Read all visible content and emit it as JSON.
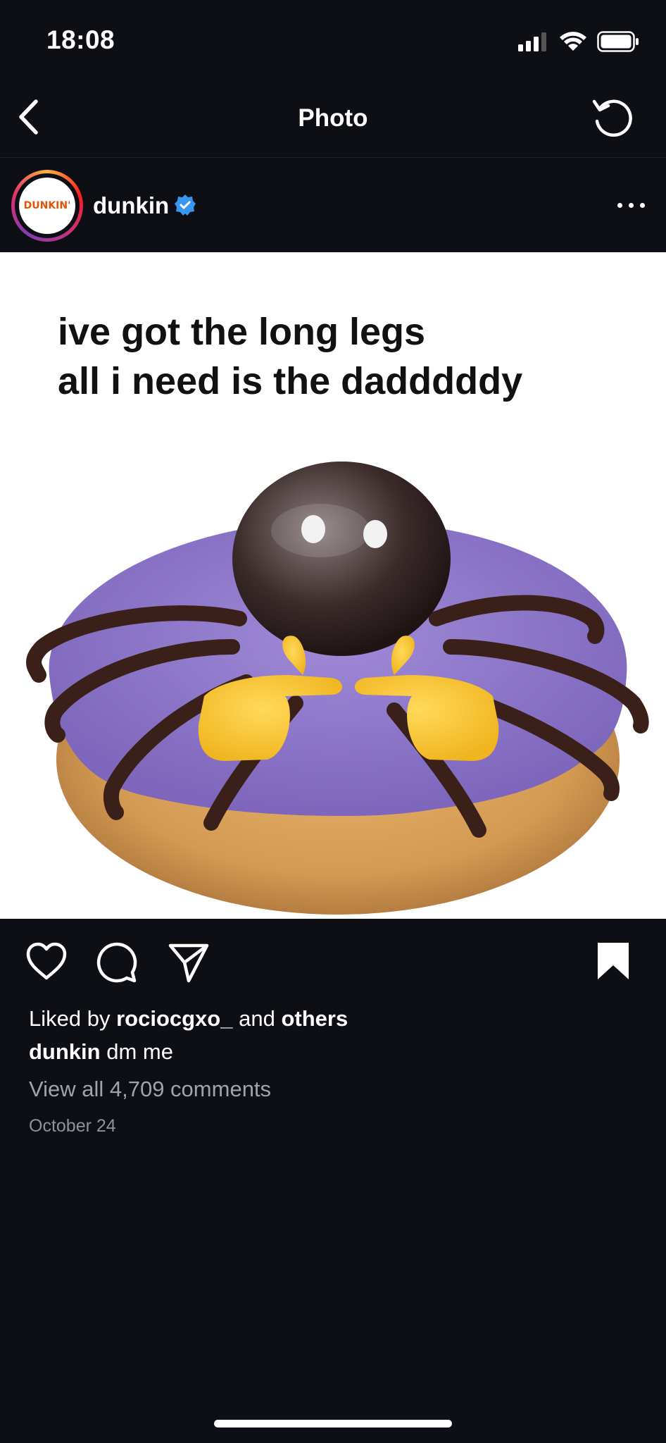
{
  "status": {
    "time": "18:08"
  },
  "nav": {
    "title": "Photo"
  },
  "post": {
    "username": "dunkin",
    "avatar_text": "DUNKIN'",
    "image_caption_line1": "ive got the long legs",
    "image_caption_line2": "all i need is the dadddddy",
    "liked_by_prefix": "Liked by",
    "liked_by_user": "rociocgxo_",
    "liked_by_and": "and",
    "liked_by_others": "others",
    "caption_user": "dunkin",
    "caption_text": "dm me",
    "view_comments": "View all 4,709 comments",
    "date": "October 24"
  },
  "colors": {
    "background": "#0d0f14",
    "verified": "#3897f0",
    "brand": "#e35205"
  }
}
